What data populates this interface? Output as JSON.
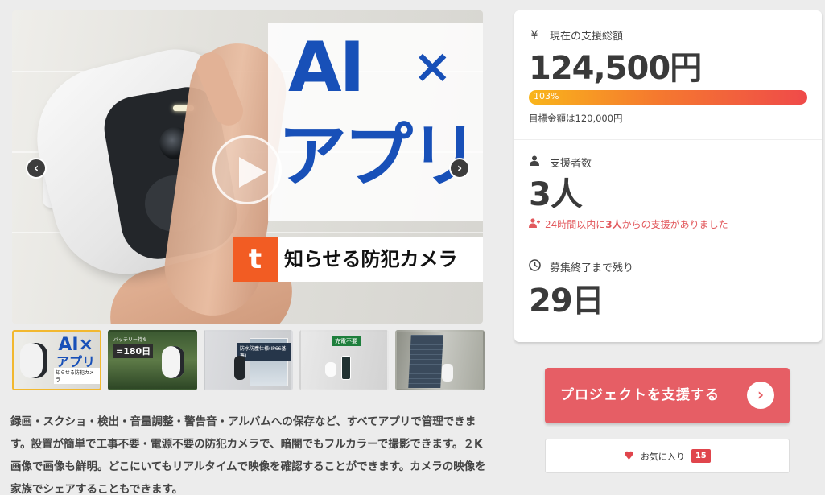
{
  "media": {
    "headline_main": "AI",
    "headline_x": "×",
    "headline_sub": "アプリ",
    "tagline_logo": "t",
    "tagline": "知らせる防犯カメラ"
  },
  "thumbnails": [
    {
      "ai": "AI",
      "x": "×",
      "app": "アプリ",
      "tag": "知らせる防犯カメラ"
    },
    {
      "top": "バッテリー持ち",
      "big": "=180日"
    },
    {
      "label": "防水防塵仕様(IP66基準)"
    },
    {
      "label": "充電不要"
    },
    {}
  ],
  "description": "録画・スクショ・検出・音量調整・警告音・アルバムへの保存など、すべてアプリで管理できます。設置が簡単で工事不要・電源不要の防犯カメラで、暗闇でもフルカラーで撮影できます。２K画像で画像も鮮明。どこにいてもリアルタイムで映像を確認することができます。カメラの映像を家族でシェアすることもできます。",
  "stats": {
    "funding": {
      "icon": "yen-icon",
      "label": "現在の支援総額",
      "amount": "124,500円",
      "percent_label": "103%",
      "percent": 1.03,
      "goal": "目標金額は120,000円"
    },
    "supporters": {
      "icon": "user-icon",
      "label": "支援者数",
      "count": "3人",
      "recent_prefix": "24時間以内に",
      "recent_count": "3人",
      "recent_suffix": "からの支援がありました"
    },
    "time_left": {
      "icon": "clock-icon",
      "label": "募集終了まで残り",
      "value": "29日"
    }
  },
  "actions": {
    "support_label": "プロジェクトを支援する",
    "fav_label": "お気に入り",
    "fav_count": "15"
  },
  "colors": {
    "accent": "#e65e65",
    "headline_blue": "#1850b8",
    "thumb_active": "#f2b82f",
    "progress_start": "#f9b51b",
    "progress_end": "#ef4a4a"
  }
}
